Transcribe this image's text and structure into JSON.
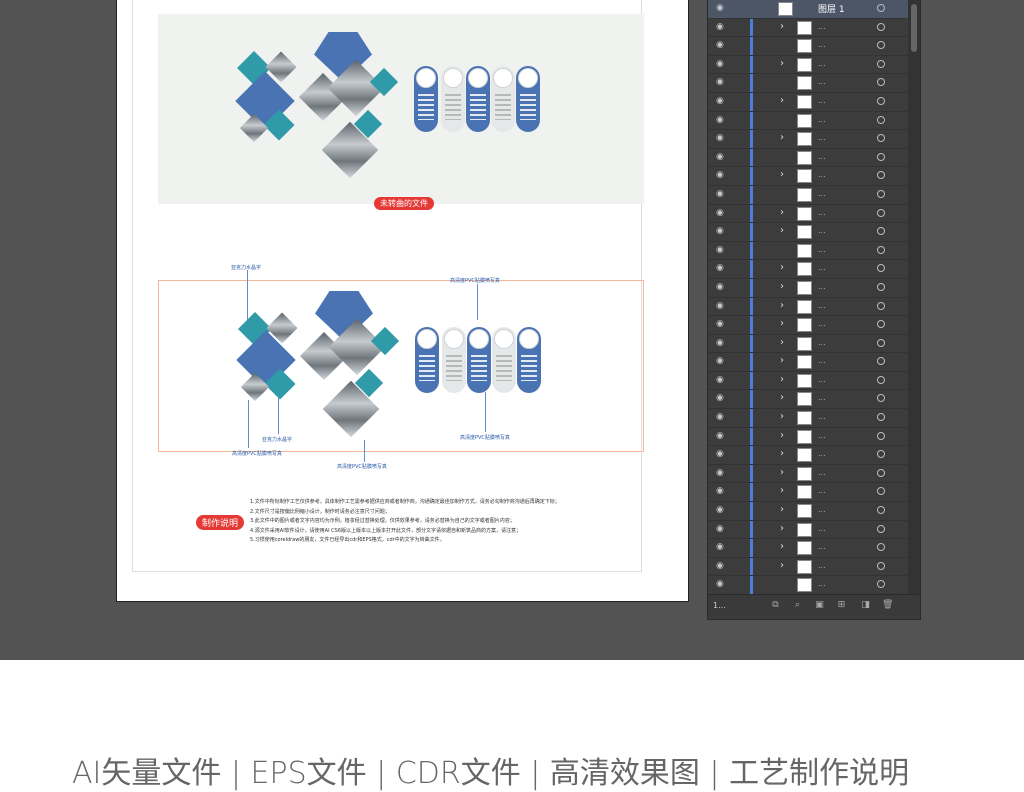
{
  "mockup": {
    "top_label": "未转曲的文件",
    "dim_labels": [
      "亚克力水晶字",
      "高清度PVC贴膜喷写真",
      "亚克力水晶字",
      "高清度PVC贴膜喷写真",
      "高清度PVC贴膜喷写真",
      "高清度PVC贴膜喷写真"
    ],
    "notes_label": "制作说明",
    "notes": [
      "1.文件中所标制作工艺仅供参考，具体制作工艺需参考据供应商或者制作商，沟通确定最佳加制作方式，请务必勾制作商沟通后再确定下标；",
      "2.文件尺寸是按偏比例缩小设计，制作时请务必注意尺寸问题；",
      "3.此文件中的图片或者文字内容均为示例，植妆经过替换处理，仅供效果参考，请务必替换为自己的文字或者图片内容；",
      "4.源文件采用AI软件设计，请使用AI CS6版以上版本以上版本打开此文件，部分文字请依据自和新筑品商的方案，请注意；",
      "5.习惯使用coreldraw的朋友，文件已经导出cdr和EPS格式，cdr中的文字为转曲文件。"
    ]
  },
  "layers_panel": {
    "top_layer_name": "图层 1",
    "row_dots": "...",
    "layer_count": "1..."
  },
  "caption": "AI矢量文件 | EPS文件 | CDR文件 | 高清效果图 | 工艺制作说明"
}
